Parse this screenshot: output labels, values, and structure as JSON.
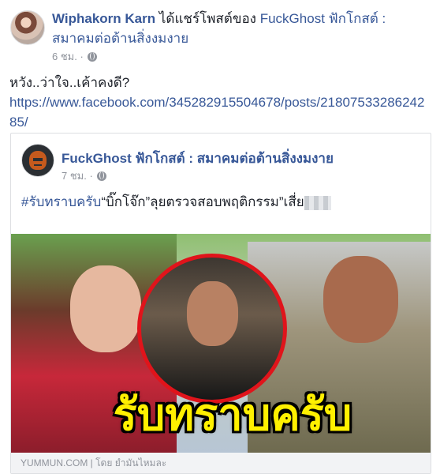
{
  "post": {
    "author": "Wiphakorn Karn",
    "shared_text": "ได้แชร์โพสต์ของ",
    "shared_page": "FuckGhost ฟักโกสต์ : สมาคมต่อต้านสิ่งงมงาย",
    "timestamp": "6 ชม. ·",
    "body": "หวัง..ว่าใจ..เค้าคงดี?",
    "link": "https://www.facebook.com/345282915504678/posts/2180753328624285/"
  },
  "shared_post": {
    "author": "FuckGhost ฟักโกสต์ : สมาคมต่อต้านสิ่งงมงาย",
    "timestamp": "7 ชม. ·",
    "hashtag": "#รับทราบครับ",
    "text": "“บิ๊กโจ๊ก”ลุยตรวจสอบพฤติกรรม”เสี่ย",
    "image_title": "รับทราบครับ",
    "footer": "YUMMUN.COM | โดย ยำมันไหมละ"
  },
  "icons": {
    "privacy": "globe-icon",
    "blur": "redacted-text"
  }
}
